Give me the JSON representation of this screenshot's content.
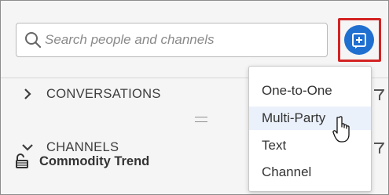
{
  "search": {
    "placeholder": "Search people and channels",
    "value": ""
  },
  "sections": {
    "conversations": "CONVERSATIONS",
    "channels": "CHANNELS"
  },
  "channels": [
    {
      "name": "Commodity Trend",
      "icon": "unlock-icon"
    }
  ],
  "new_conversation_menu": {
    "items": [
      "One-to-One",
      "Multi-Party",
      "Text",
      "Channel"
    ],
    "hovered": "Multi-Party"
  },
  "colors": {
    "accent": "#1f6fd1",
    "highlight_box": "#d32323",
    "background": "#f5f5f5"
  }
}
